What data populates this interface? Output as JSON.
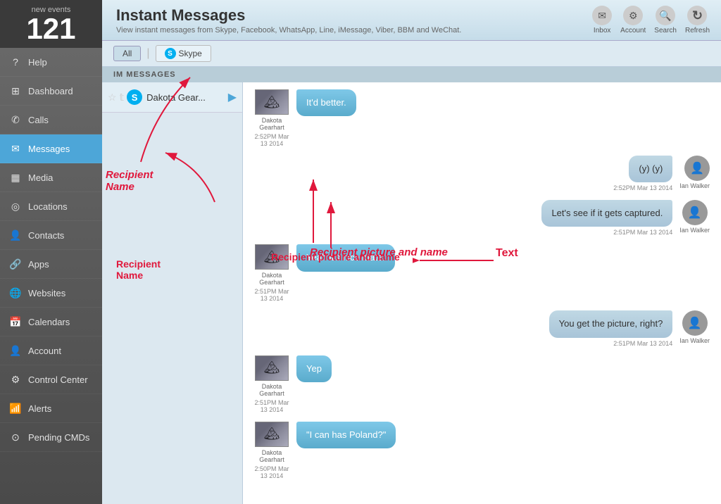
{
  "sidebar": {
    "events_label": "new events",
    "events_count": "121",
    "items": [
      {
        "id": "help",
        "label": "Help",
        "icon": "?",
        "active": false
      },
      {
        "id": "dashboard",
        "label": "Dashboard",
        "icon": "⊞",
        "active": false
      },
      {
        "id": "calls",
        "label": "Calls",
        "icon": "📞",
        "active": false
      },
      {
        "id": "messages",
        "label": "Messages",
        "icon": "✉",
        "active": true
      },
      {
        "id": "media",
        "label": "Media",
        "icon": "🖼",
        "active": false
      },
      {
        "id": "locations",
        "label": "Locations",
        "icon": "📍",
        "active": false
      },
      {
        "id": "contacts",
        "label": "Contacts",
        "icon": "👤",
        "active": false
      },
      {
        "id": "apps",
        "label": "Apps",
        "icon": "🔗",
        "active": false
      },
      {
        "id": "websites",
        "label": "Websites",
        "icon": "🌐",
        "active": false
      },
      {
        "id": "calendars",
        "label": "Calendars",
        "icon": "📅",
        "active": false
      },
      {
        "id": "account",
        "label": "Account",
        "icon": "👤",
        "active": false
      },
      {
        "id": "control-center",
        "label": "Control Center",
        "icon": "⚙",
        "active": false
      },
      {
        "id": "alerts",
        "label": "Alerts",
        "icon": "📶",
        "active": false
      },
      {
        "id": "pending-cmds",
        "label": "Pending CMDs",
        "icon": "⊙",
        "active": false
      }
    ]
  },
  "header": {
    "title": "Instant Messages",
    "subtitle": "View instant messages from Skype, Facebook, WhatsApp, Line, iMessage, Viber, BBM and WeChat."
  },
  "topbar_actions": [
    {
      "id": "inbox",
      "label": "Inbox",
      "icon": "✉"
    },
    {
      "id": "account",
      "label": "Account",
      "icon": "⚙"
    },
    {
      "id": "search",
      "label": "Search",
      "icon": "🔍"
    },
    {
      "id": "refresh",
      "label": "Refresh",
      "icon": "↻"
    }
  ],
  "filters": {
    "all_label": "All",
    "skype_label": "Skype"
  },
  "im_messages_header": "IM MESSAGES",
  "conversation": {
    "name": "Dakota Gear...",
    "full_name": "Dakota Gearhart"
  },
  "annotations": {
    "recipient_name": "Recipient Name",
    "recipient_picture": "Recipient picture and name",
    "text_label": "Text"
  },
  "messages": [
    {
      "id": "msg1",
      "side": "left",
      "sender": "Dakota Gearhart",
      "text": "It'd better.",
      "time": "2:52PM Mar 13 2014"
    },
    {
      "id": "msg2",
      "side": "right",
      "sender": "Ian Walker",
      "text": "(y) (y)",
      "time": "2:52PM Mar 13 2014"
    },
    {
      "id": "msg3",
      "side": "right",
      "sender": "Ian Walker",
      "text": "Let's see if it gets captured.",
      "time": "2:51PM Mar 13 2014"
    },
    {
      "id": "msg4",
      "side": "left",
      "sender": "Dakota Gearhart",
      "text": "Yeah it's nice mate.",
      "time": "2:51PM Mar 13 2014"
    },
    {
      "id": "msg5",
      "side": "right",
      "sender": "Ian Walker",
      "text": "You get the picture, right?",
      "time": "2:51PM Mar 13 2014"
    },
    {
      "id": "msg6",
      "side": "left",
      "sender": "Dakota Gearhart",
      "text": "Yep",
      "time": "2:51PM Mar 13 2014"
    },
    {
      "id": "msg7",
      "side": "left",
      "sender": "Dakota Gearhart",
      "text": "\"I can has Poland?\"",
      "time": "2:50PM Mar 13 2014"
    }
  ]
}
